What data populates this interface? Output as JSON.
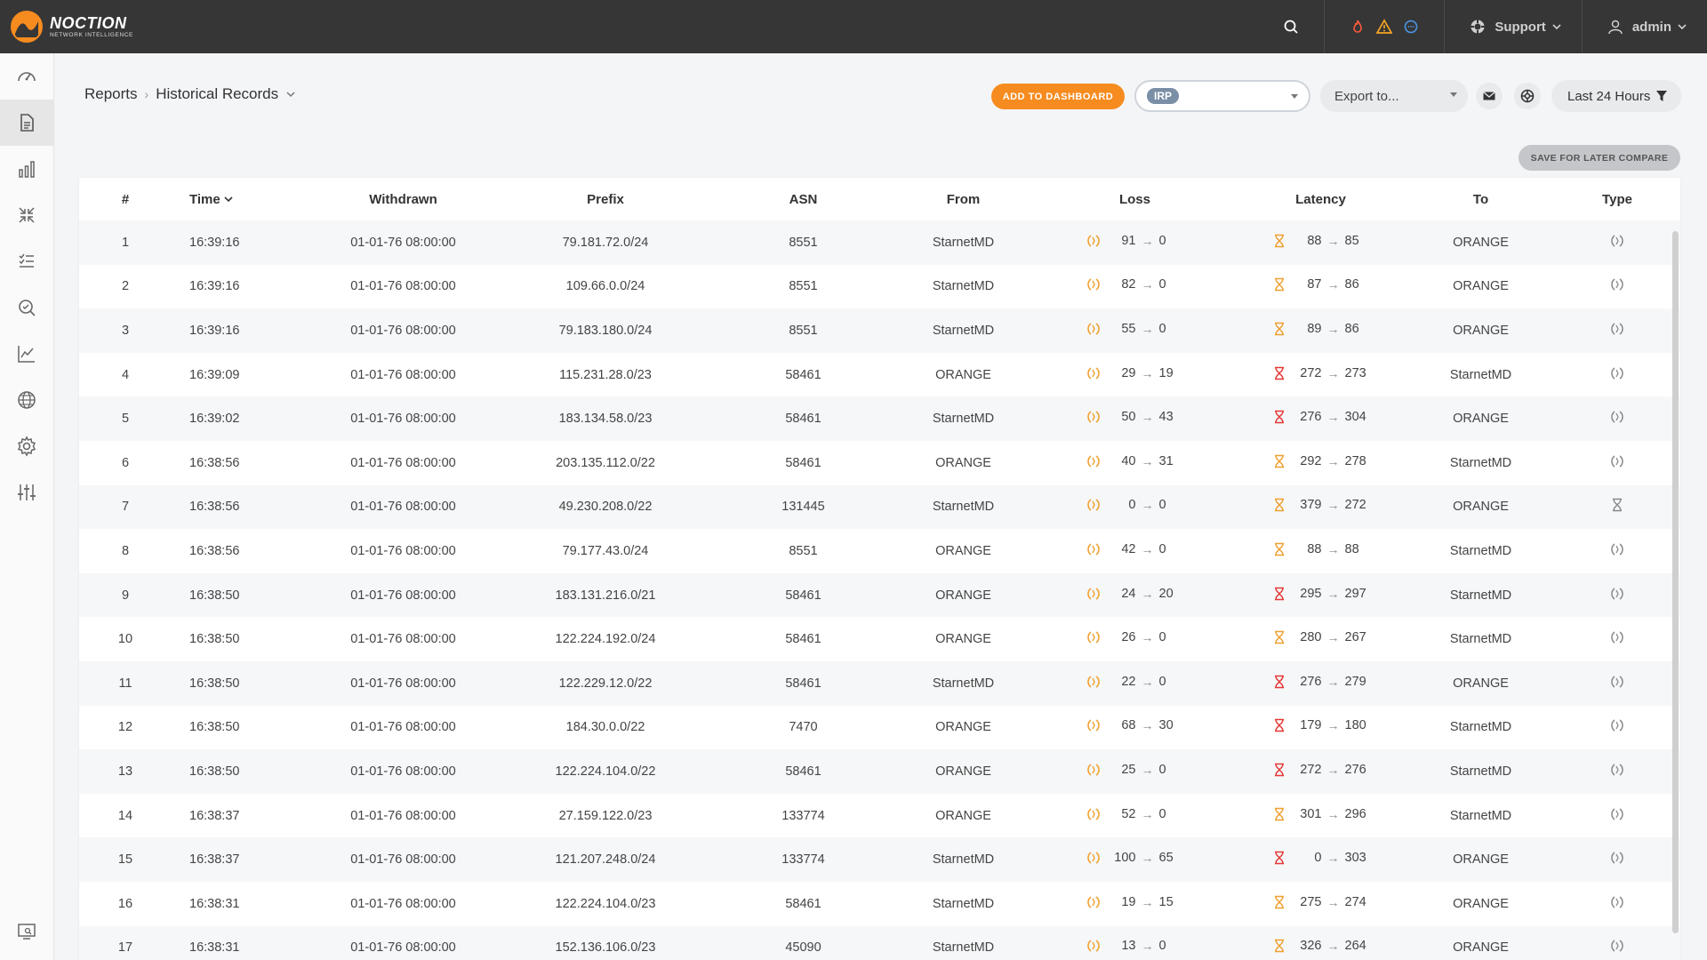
{
  "app": {
    "logo_name": "NOCTION",
    "logo_sub": "NETWORK INTELLIGENCE"
  },
  "topbar": {
    "support_label": "Support",
    "user_label": "admin"
  },
  "breadcrumb": {
    "root": "Reports",
    "current": "Historical Records"
  },
  "toolbar": {
    "add_to_dashboard": "ADD TO DASHBOARD",
    "irp_tag": "IRP",
    "export_placeholder": "Export to...",
    "time_range": "Last 24 Hours",
    "save_compare": "SAVE FOR LATER COMPARE"
  },
  "colors": {
    "accent": "#f68b1f",
    "loss_icon": "#f0a030",
    "latency_red": "#e53935",
    "latency_orange": "#f0a030"
  },
  "table": {
    "headers": {
      "num": "#",
      "time": "Time",
      "withdrawn": "Withdrawn",
      "prefix": "Prefix",
      "asn": "ASN",
      "from": "From",
      "loss": "Loss",
      "latency": "Latency",
      "to": "To",
      "type": "Type"
    },
    "rows": [
      {
        "num": "1",
        "time": "16:39:16",
        "withdrawn": "01-01-76 08:00:00",
        "prefix": "79.181.72.0/24",
        "asn": "8551",
        "from": "StarnetMD",
        "loss_a": "91",
        "loss_b": "0",
        "lat_a": "88",
        "lat_b": "85",
        "lat_color": "orange",
        "to": "ORANGE",
        "type": "loss"
      },
      {
        "num": "2",
        "time": "16:39:16",
        "withdrawn": "01-01-76 08:00:00",
        "prefix": "109.66.0.0/24",
        "asn": "8551",
        "from": "StarnetMD",
        "loss_a": "82",
        "loss_b": "0",
        "lat_a": "87",
        "lat_b": "86",
        "lat_color": "orange",
        "to": "ORANGE",
        "type": "loss"
      },
      {
        "num": "3",
        "time": "16:39:16",
        "withdrawn": "01-01-76 08:00:00",
        "prefix": "79.183.180.0/24",
        "asn": "8551",
        "from": "StarnetMD",
        "loss_a": "55",
        "loss_b": "0",
        "lat_a": "89",
        "lat_b": "86",
        "lat_color": "orange",
        "to": "ORANGE",
        "type": "loss"
      },
      {
        "num": "4",
        "time": "16:39:09",
        "withdrawn": "01-01-76 08:00:00",
        "prefix": "115.231.28.0/23",
        "asn": "58461",
        "from": "ORANGE",
        "loss_a": "29",
        "loss_b": "19",
        "lat_a": "272",
        "lat_b": "273",
        "lat_color": "red",
        "to": "StarnetMD",
        "type": "loss"
      },
      {
        "num": "5",
        "time": "16:39:02",
        "withdrawn": "01-01-76 08:00:00",
        "prefix": "183.134.58.0/23",
        "asn": "58461",
        "from": "StarnetMD",
        "loss_a": "50",
        "loss_b": "43",
        "lat_a": "276",
        "lat_b": "304",
        "lat_color": "red",
        "to": "ORANGE",
        "type": "loss"
      },
      {
        "num": "6",
        "time": "16:38:56",
        "withdrawn": "01-01-76 08:00:00",
        "prefix": "203.135.112.0/22",
        "asn": "58461",
        "from": "ORANGE",
        "loss_a": "40",
        "loss_b": "31",
        "lat_a": "292",
        "lat_b": "278",
        "lat_color": "orange",
        "to": "StarnetMD",
        "type": "loss"
      },
      {
        "num": "7",
        "time": "16:38:56",
        "withdrawn": "01-01-76 08:00:00",
        "prefix": "49.230.208.0/22",
        "asn": "131445",
        "from": "StarnetMD",
        "loss_a": "0",
        "loss_b": "0",
        "lat_a": "379",
        "lat_b": "272",
        "lat_color": "orange",
        "to": "ORANGE",
        "type": "latency"
      },
      {
        "num": "8",
        "time": "16:38:56",
        "withdrawn": "01-01-76 08:00:00",
        "prefix": "79.177.43.0/24",
        "asn": "8551",
        "from": "ORANGE",
        "loss_a": "42",
        "loss_b": "0",
        "lat_a": "88",
        "lat_b": "88",
        "lat_color": "orange",
        "to": "StarnetMD",
        "type": "loss"
      },
      {
        "num": "9",
        "time": "16:38:50",
        "withdrawn": "01-01-76 08:00:00",
        "prefix": "183.131.216.0/21",
        "asn": "58461",
        "from": "ORANGE",
        "loss_a": "24",
        "loss_b": "20",
        "lat_a": "295",
        "lat_b": "297",
        "lat_color": "red",
        "to": "StarnetMD",
        "type": "loss"
      },
      {
        "num": "10",
        "time": "16:38:50",
        "withdrawn": "01-01-76 08:00:00",
        "prefix": "122.224.192.0/24",
        "asn": "58461",
        "from": "ORANGE",
        "loss_a": "26",
        "loss_b": "0",
        "lat_a": "280",
        "lat_b": "267",
        "lat_color": "orange",
        "to": "StarnetMD",
        "type": "loss"
      },
      {
        "num": "11",
        "time": "16:38:50",
        "withdrawn": "01-01-76 08:00:00",
        "prefix": "122.229.12.0/22",
        "asn": "58461",
        "from": "StarnetMD",
        "loss_a": "22",
        "loss_b": "0",
        "lat_a": "276",
        "lat_b": "279",
        "lat_color": "red",
        "to": "ORANGE",
        "type": "loss"
      },
      {
        "num": "12",
        "time": "16:38:50",
        "withdrawn": "01-01-76 08:00:00",
        "prefix": "184.30.0.0/22",
        "asn": "7470",
        "from": "ORANGE",
        "loss_a": "68",
        "loss_b": "30",
        "lat_a": "179",
        "lat_b": "180",
        "lat_color": "red",
        "to": "StarnetMD",
        "type": "loss"
      },
      {
        "num": "13",
        "time": "16:38:50",
        "withdrawn": "01-01-76 08:00:00",
        "prefix": "122.224.104.0/22",
        "asn": "58461",
        "from": "ORANGE",
        "loss_a": "25",
        "loss_b": "0",
        "lat_a": "272",
        "lat_b": "276",
        "lat_color": "red",
        "to": "StarnetMD",
        "type": "loss"
      },
      {
        "num": "14",
        "time": "16:38:37",
        "withdrawn": "01-01-76 08:00:00",
        "prefix": "27.159.122.0/23",
        "asn": "133774",
        "from": "ORANGE",
        "loss_a": "52",
        "loss_b": "0",
        "lat_a": "301",
        "lat_b": "296",
        "lat_color": "orange",
        "to": "StarnetMD",
        "type": "loss"
      },
      {
        "num": "15",
        "time": "16:38:37",
        "withdrawn": "01-01-76 08:00:00",
        "prefix": "121.207.248.0/24",
        "asn": "133774",
        "from": "StarnetMD",
        "loss_a": "100",
        "loss_b": "65",
        "lat_a": "0",
        "lat_b": "303",
        "lat_color": "red",
        "to": "ORANGE",
        "type": "loss"
      },
      {
        "num": "16",
        "time": "16:38:31",
        "withdrawn": "01-01-76 08:00:00",
        "prefix": "122.224.104.0/23",
        "asn": "58461",
        "from": "StarnetMD",
        "loss_a": "19",
        "loss_b": "15",
        "lat_a": "275",
        "lat_b": "274",
        "lat_color": "orange",
        "to": "ORANGE",
        "type": "loss"
      },
      {
        "num": "17",
        "time": "16:38:31",
        "withdrawn": "01-01-76 08:00:00",
        "prefix": "152.136.106.0/23",
        "asn": "45090",
        "from": "StarnetMD",
        "loss_a": "13",
        "loss_b": "0",
        "lat_a": "326",
        "lat_b": "264",
        "lat_color": "orange",
        "to": "ORANGE",
        "type": "loss"
      }
    ]
  }
}
